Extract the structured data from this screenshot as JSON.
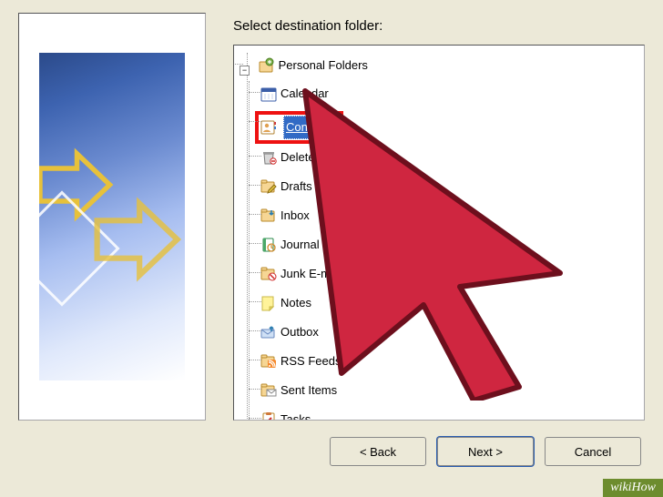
{
  "instruction": "Select destination folder:",
  "tree": {
    "root_label": "Personal Folders",
    "items": [
      "Calendar",
      "Contacts",
      "Deleted Items",
      "Drafts",
      "Inbox",
      "Journal",
      "Junk E-mail",
      "Notes",
      "Outbox",
      "RSS Feeds",
      "Sent Items",
      "Tasks"
    ],
    "selected_index": 1
  },
  "buttons": {
    "back": "< Back",
    "next": "Next >",
    "cancel": "Cancel"
  },
  "expander_glyph": "−",
  "watermark": "wikiHow"
}
